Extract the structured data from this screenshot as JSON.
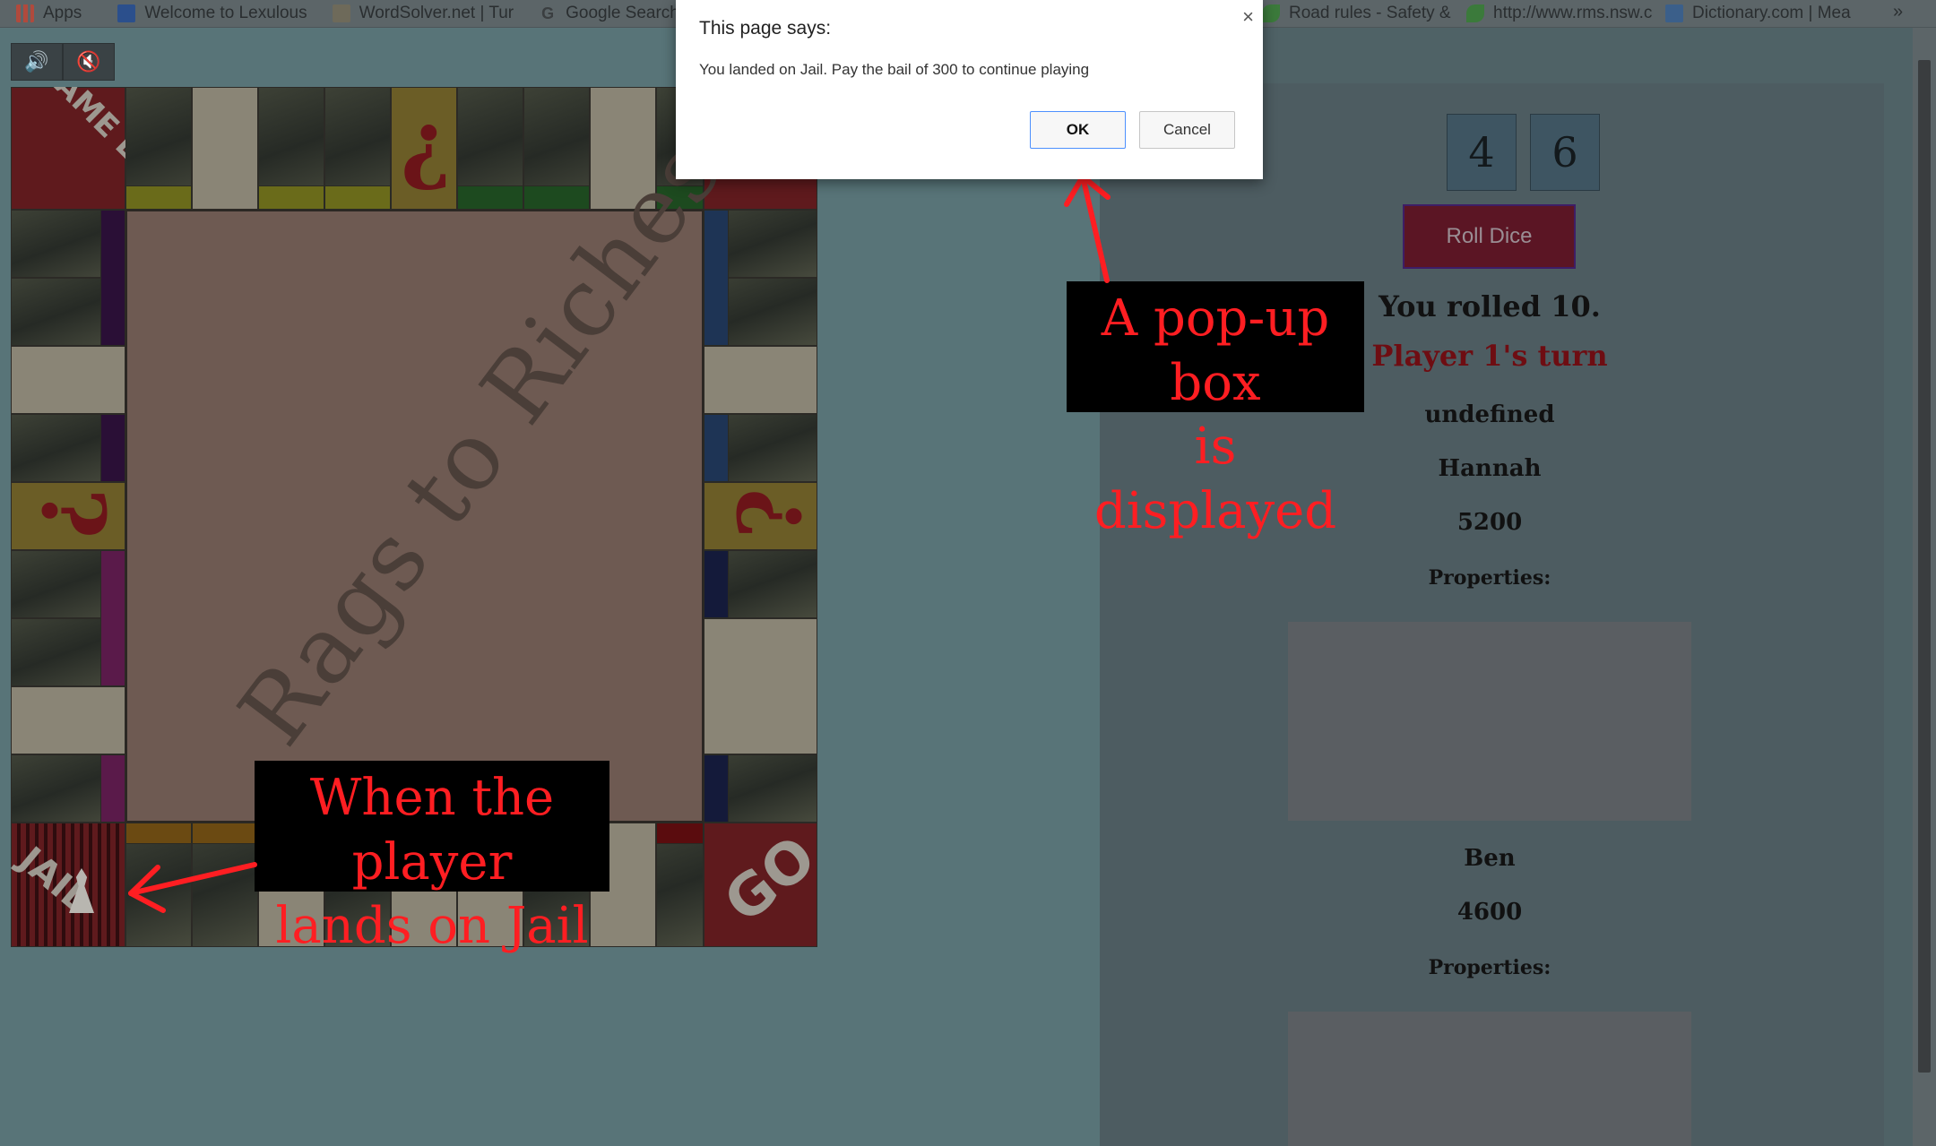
{
  "bookmarks": {
    "items": [
      {
        "label": "Apps",
        "icon": "apps-grid-icon",
        "color": "#b04a3d"
      },
      {
        "label": "Welcome to Lexulous",
        "icon": "lexulous-icon",
        "color": "#2b4f8c"
      },
      {
        "label": "WordSolver.net | Tur",
        "icon": "wordsolver-icon",
        "color": "#6e6a5a"
      },
      {
        "label": "Google Search",
        "icon": "google-icon",
        "color": "#5a5e60"
      },
      {
        "label": "Road rules - Safety &",
        "icon": "nsw-leaf-icon",
        "color": "#3b7a3b"
      },
      {
        "label": "http://www.rms.nsw.c",
        "icon": "nsw-leaf-icon",
        "color": "#3b7a3b"
      },
      {
        "label": "Dictionary.com | Mea",
        "icon": "dictionary-icon",
        "color": "#3b5f8a"
      }
    ],
    "overflow": "»"
  },
  "controls": {
    "sound_on_icon": "speaker-on-icon",
    "sound_off_icon": "speaker-mute-icon",
    "sound_on_glyph": "🔊",
    "sound_off_glyph": "🔇"
  },
  "board": {
    "title": "Rags to Riches",
    "corners": {
      "top_left": "GAME LUCK",
      "bottom_left": "JAIL",
      "bottom_right": "GO"
    },
    "chance_glyph_inverted": "¿",
    "chance_glyph": "?"
  },
  "dice": {
    "die1": "4",
    "die2": "6"
  },
  "roll_button": "Roll Dice",
  "status": {
    "rolled": "You rolled 10.",
    "turn": "Player 1's turn",
    "message": "undefined"
  },
  "players": [
    {
      "name": "Hannah",
      "money": "5200",
      "properties_label": "Properties:"
    },
    {
      "name": "Ben",
      "money": "4600",
      "properties_label": "Properties:"
    }
  ],
  "dialog": {
    "title": "This page says:",
    "message": "You landed on Jail. Pay the bail of 300 to continue playing",
    "ok": "OK",
    "cancel": "Cancel",
    "close_icon": "×"
  },
  "annotations": {
    "popup_line1": "A pop-up box",
    "popup_line2": "is displayed",
    "jail_line1": "When the player",
    "jail_line2": "lands on Jail"
  },
  "colors": {
    "annotation_text": "#ff1e22",
    "roll_button": "#5b1524",
    "turn_text": "#6e0d12"
  }
}
